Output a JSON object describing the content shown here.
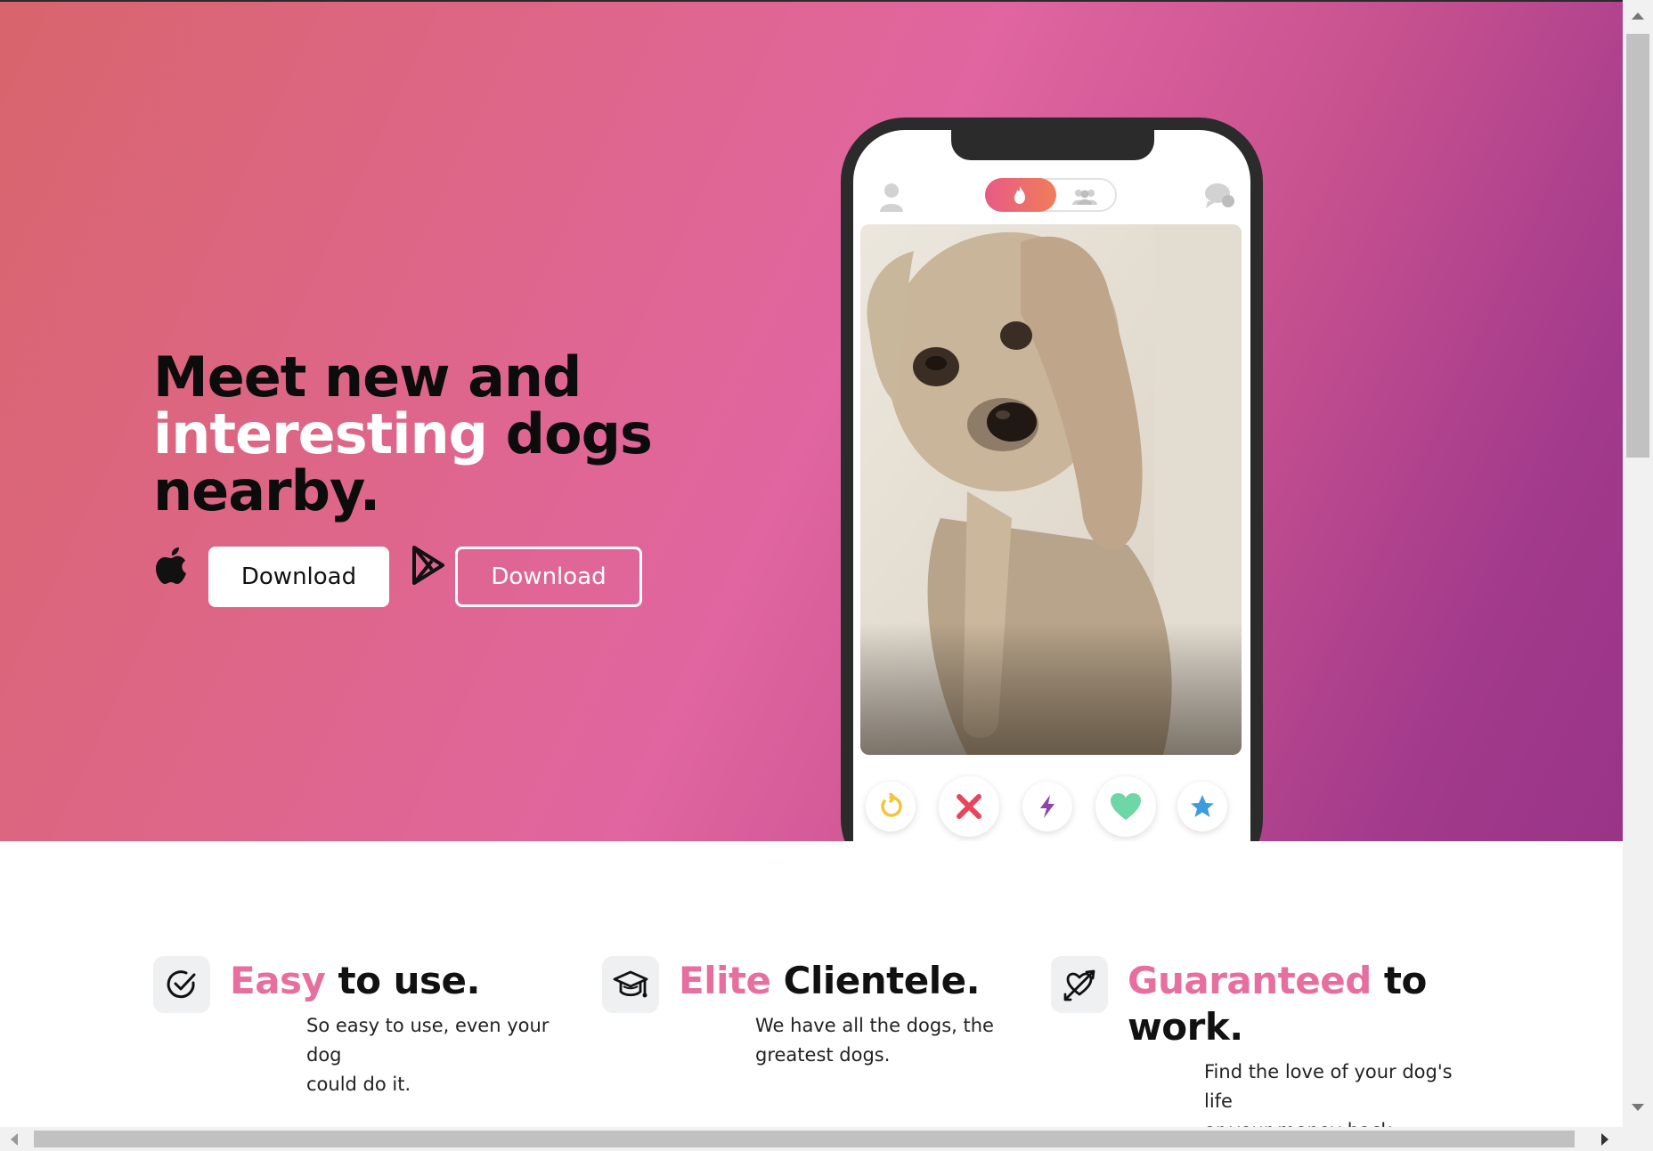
{
  "hero": {
    "headline_line1": "Meet new and",
    "headline_highlight": "interesting",
    "headline_line2_rest": " dogs",
    "headline_line3": "nearby.",
    "ios_button_label": "Download",
    "android_button_label": "Download",
    "icons": [
      "apple-icon",
      "google-play-icon"
    ]
  },
  "phone": {
    "top_icons": [
      "profile-icon",
      "flame-icon",
      "group-icon",
      "chat-icon"
    ],
    "action_buttons": [
      "rewind-icon",
      "nope-x-icon",
      "boost-bolt-icon",
      "like-heart-icon",
      "super-like-star-icon"
    ]
  },
  "features": [
    {
      "accent": "Easy",
      "rest": " to use.",
      "description_line1": "So easy to use, even your dog",
      "description_line2": "could do it.",
      "icon": "check-circle-icon"
    },
    {
      "accent": "Elite",
      "rest": " Clientele.",
      "description_line1": "We have all the dogs, the",
      "description_line2": "greatest dogs.",
      "icon": "graduation-cap-icon"
    },
    {
      "accent": "Guaranteed",
      "rest_line1": " to",
      "rest_line2": "work.",
      "description_line1": "Find the love of your dog's life",
      "description_line2": "or your money back.",
      "icon": "heart-arrow-icon"
    }
  ],
  "colors": {
    "accent_pink": "#e76fa0",
    "hero_gradient_start": "#d8656c",
    "hero_gradient_end": "#993486",
    "dark": "#0c0c0c"
  }
}
